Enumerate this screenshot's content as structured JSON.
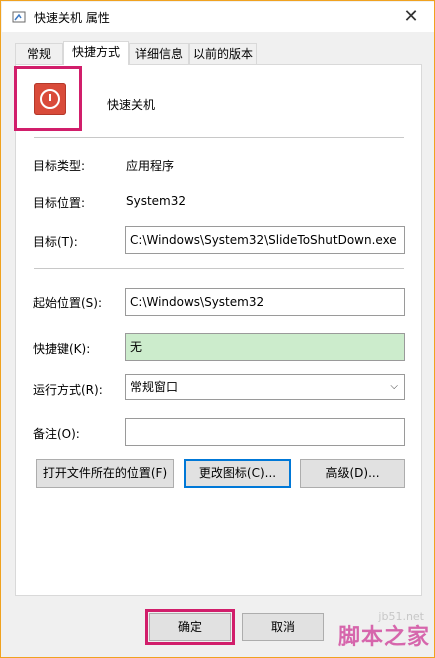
{
  "window": {
    "title": "快速关机 属性",
    "close": "✕"
  },
  "tabs": [
    "常规",
    "快捷方式",
    "详细信息",
    "以前的版本"
  ],
  "shortcut": {
    "name": "快速关机",
    "target_type_label": "目标类型:",
    "target_type_value": "应用程序",
    "target_location_label": "目标位置:",
    "target_location_value": "System32",
    "target_label": "目标(T):",
    "target_value": "C:\\Windows\\System32\\SlideToShutDown.exe",
    "start_in_label": "起始位置(S):",
    "start_in_value": "C:\\Windows\\System32",
    "hotkey_label": "快捷键(K):",
    "hotkey_value": "无",
    "run_label": "运行方式(R):",
    "run_value": "常规窗口",
    "comment_label": "备注(O):",
    "comment_value": ""
  },
  "buttons": {
    "open_location": "打开文件所在的位置(F)",
    "change_icon": "更改图标(C)...",
    "advanced": "高级(D)...",
    "ok": "确定",
    "cancel": "取消"
  },
  "watermark": {
    "text": "脚本之家",
    "url": "jb51.net"
  },
  "colors": {
    "highlight": "#d11e6b",
    "icon_red": "#d94b3a",
    "hotkey_bg": "#cceccc"
  }
}
